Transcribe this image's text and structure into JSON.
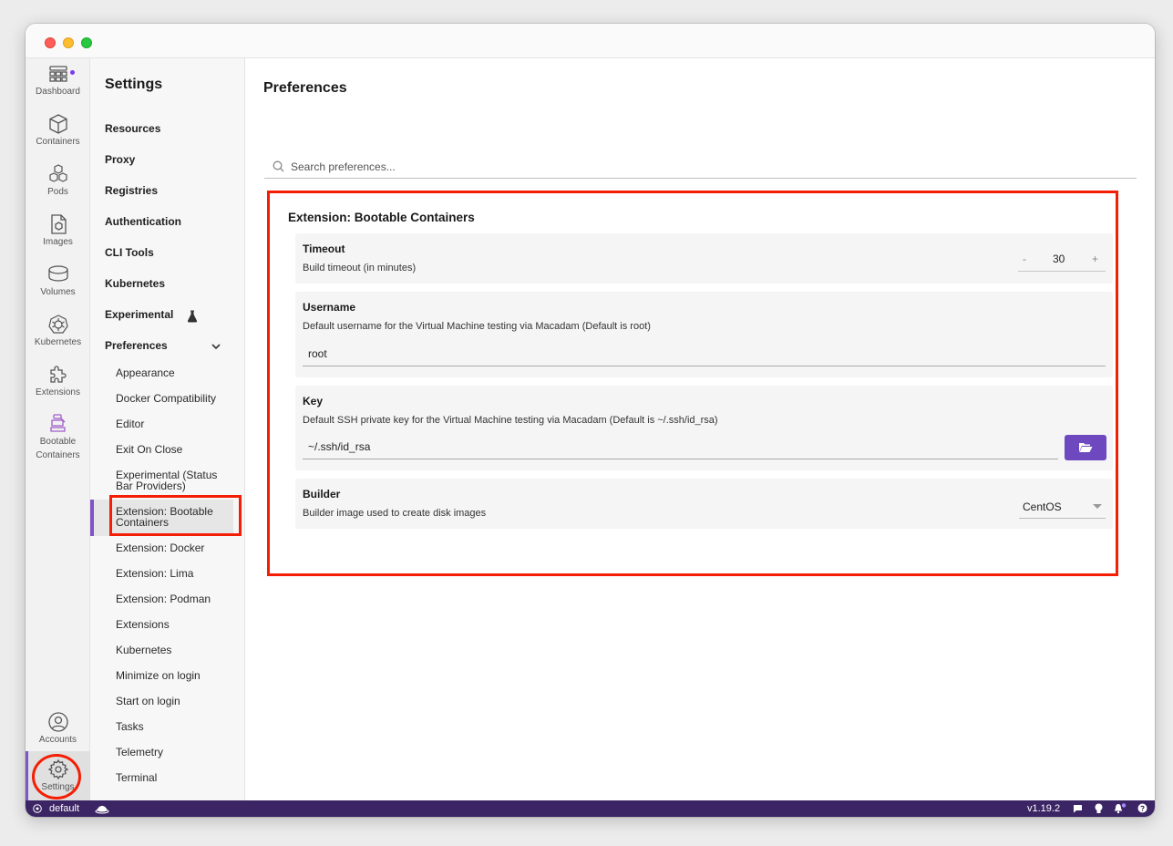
{
  "navbar": {
    "items": [
      {
        "label": "Dashboard",
        "icon": "dashboard-icon"
      },
      {
        "label": "Containers",
        "icon": "container-icon"
      },
      {
        "label": "Pods",
        "icon": "pods-icon"
      },
      {
        "label": "Images",
        "icon": "images-icon"
      },
      {
        "label": "Volumes",
        "icon": "volumes-icon"
      },
      {
        "label": "Kubernetes",
        "icon": "kubernetes-icon"
      },
      {
        "label": "Extensions",
        "icon": "puzzle-icon"
      },
      {
        "label": "Bootable Containers",
        "icon": "bootable-containers-icon"
      },
      {
        "label": "Accounts",
        "icon": "account-icon"
      },
      {
        "label": "Settings",
        "icon": "gear-icon"
      }
    ]
  },
  "sidebar": {
    "title": "Settings",
    "items": [
      "Resources",
      "Proxy",
      "Registries",
      "Authentication",
      "CLI Tools",
      "Kubernetes",
      "Experimental",
      "Preferences"
    ],
    "sub_items": [
      "Appearance",
      "Docker Compatibility",
      "Editor",
      "Exit On Close",
      "Experimental (Status Bar Providers)",
      "Extension: Bootable Containers",
      "Extension: Docker",
      "Extension: Lima",
      "Extension: Podman",
      "Extensions",
      "Kubernetes",
      "Minimize on login",
      "Start on login",
      "Tasks",
      "Telemetry",
      "Terminal"
    ]
  },
  "main": {
    "title": "Preferences",
    "search": {
      "placeholder": "Search preferences..."
    },
    "section_title": "Extension: Bootable Containers",
    "timeout": {
      "title": "Timeout",
      "description": "Build timeout (in minutes)",
      "value": "30",
      "minus": "-",
      "plus": "+"
    },
    "username": {
      "title": "Username",
      "description": "Default username for the Virtual Machine testing via Macadam (Default is root)",
      "value": "root"
    },
    "key": {
      "title": "Key",
      "description": "Default SSH private key for the Virtual Machine testing via Macadam (Default is ~/.ssh/id_rsa)",
      "value": "~/.ssh/id_rsa"
    },
    "builder": {
      "title": "Builder",
      "description": "Builder image used to create disk images",
      "value": "CentOS"
    }
  },
  "statusbar": {
    "context": "default",
    "version": "v1.19.2"
  },
  "colors": {
    "accent": "#7e54c6",
    "highlight": "#f41e04",
    "statusbar": "#3b2564",
    "button": "#6d48bf"
  }
}
